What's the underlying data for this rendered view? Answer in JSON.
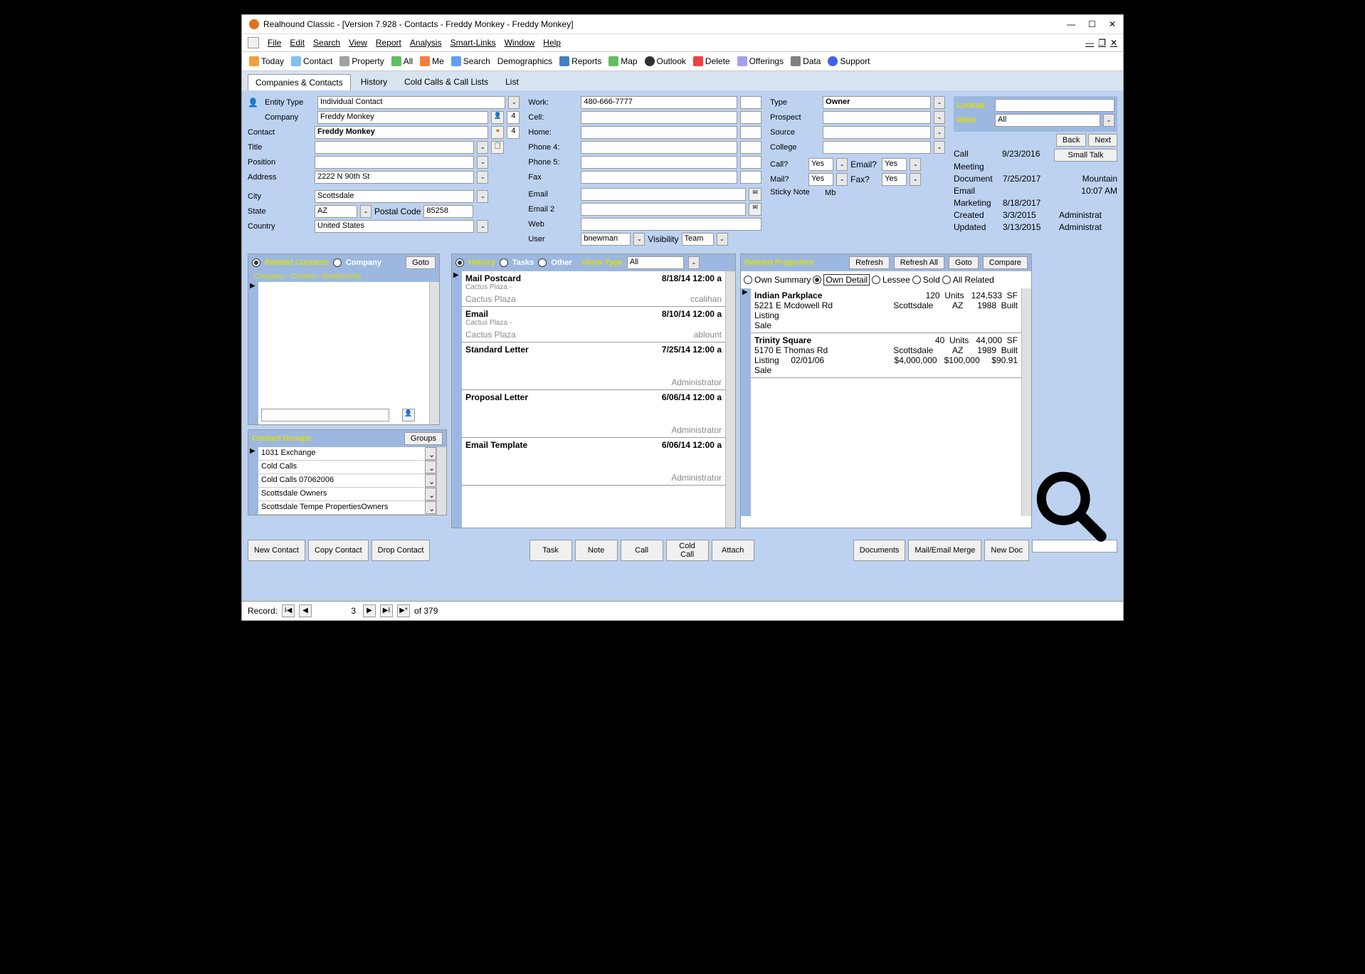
{
  "window": {
    "title": "Realhound Classic - [Version 7.928 - Contacts - Freddy Monkey - Freddy Monkey]"
  },
  "menubar": {
    "items": [
      "File",
      "Edit",
      "Search",
      "View",
      "Report",
      "Analysis",
      "Smart-Links",
      "Window",
      "Help"
    ]
  },
  "toolbar": {
    "items": [
      "Today",
      "Contact",
      "Property",
      "All",
      "Me",
      "Search",
      "Demographics",
      "Reports",
      "Map",
      "Outlook",
      "Delete",
      "Offerings",
      "Data",
      "Support"
    ]
  },
  "tabs": {
    "items": [
      "Companies & Contacts",
      "History",
      "Cold Calls & Call Lists",
      "List"
    ],
    "active": 0
  },
  "contact": {
    "entity_type_label": "Entity Type",
    "entity_type": "Individual Contact",
    "company_label": "Company",
    "company": "Freddy Monkey",
    "company_count": "4",
    "contact_label": "Contact",
    "contact": "Freddy Monkey",
    "contact_count": "4",
    "title_label": "Title",
    "title": "",
    "position_label": "Position",
    "position": "",
    "address_label": "Address",
    "address": "2222 N 90th St",
    "city_label": "City",
    "city": "Scottsdale",
    "state_label": "State",
    "state": "AZ",
    "postal_label": "Postal Code",
    "postal": "85258",
    "country_label": "Country",
    "country": "United States"
  },
  "phones": {
    "work_label": "Work:",
    "work": "480-666-7777",
    "cell_label": "Cell:",
    "cell": "",
    "home_label": "Home:",
    "home": "",
    "p4_label": "Phone 4:",
    "p4": "",
    "p5_label": "Phone 5:",
    "p5": "",
    "fax_label": "Fax",
    "fax": "",
    "email_label": "Email",
    "email": "",
    "email2_label": "Email 2",
    "email2": "",
    "web_label": "Web",
    "web": "",
    "user_label": "User",
    "user": "bnewman",
    "visibility_label": "Visibility",
    "visibility": "Team"
  },
  "classify": {
    "type_label": "Type",
    "type": "Owner",
    "prospect_label": "Prospect",
    "prospect": "",
    "source_label": "Source",
    "source": "",
    "college_label": "College",
    "college": "",
    "call_label": "Call?",
    "call": "Yes",
    "email_q_label": "Email?",
    "email_q": "Yes",
    "mail_label": "Mail?",
    "mail": "Yes",
    "fax_q_label": "Fax?",
    "fax_q": "Yes",
    "sticky_label": "Sticky Note",
    "sticky": "Mb"
  },
  "lookup": {
    "lookup_label": "Lookup",
    "what_label": "What",
    "what": "All",
    "back": "Back",
    "next": "Next",
    "smalltalk": "Small Talk"
  },
  "info": {
    "call_label": "Call",
    "call": "9/23/2016",
    "meeting_label": "Meeting",
    "meeting": "",
    "document_label": "Document",
    "document": "7/25/2017",
    "mountain": "Mountain",
    "email_label": "Email",
    "email": "",
    "time": "10:07 AM",
    "marketing_label": "Marketing",
    "marketing": "8/18/2017",
    "created_label": "Created",
    "created": "3/3/2015",
    "created_by": "Administrat",
    "updated_label": "Updated",
    "updated": "3/13/2015",
    "updated_by": "Administrat"
  },
  "related_contacts": {
    "rc_label": "Related Contacts",
    "company_label": "Company",
    "goto": "Goto",
    "columns": "Company - Contact - Relationship"
  },
  "history_panel": {
    "history_label": "History",
    "tasks_label": "Tasks",
    "other_label": "Other",
    "show_label": "Show Type",
    "show": "All",
    "items": [
      {
        "title": "Mail Postcard",
        "date": "8/18/14 12:00 a",
        "sub": "Cactus Plaza -",
        "foot_l": "Cactus Plaza",
        "foot_r": "ccalihan"
      },
      {
        "title": "Email",
        "date": "8/10/14 12:00 a",
        "sub": "Cactus Plaza -",
        "foot_l": "Cactus Plaza",
        "foot_r": "ablount"
      },
      {
        "title": "Standard Letter",
        "date": "7/25/14 12:00 a",
        "sub": "",
        "foot_l": "",
        "foot_r": "Administrator"
      },
      {
        "title": "Proposal Letter",
        "date": "6/06/14 12:00 a",
        "sub": "",
        "foot_l": "",
        "foot_r": "Administrator"
      },
      {
        "title": "Email Template",
        "date": "6/06/14 12:00 a",
        "sub": "",
        "foot_l": "",
        "foot_r": "Administrator"
      }
    ]
  },
  "contact_groups": {
    "title": "Contact Groups",
    "groups_btn": "Groups",
    "items": [
      "1031 Exchange",
      "Cold Calls",
      "Cold Calls 07062006",
      "Scottsdale Owners",
      "Scottsdale Tempe PropertiesOwners"
    ]
  },
  "related_props": {
    "title": "Related Properties",
    "refresh": "Refresh",
    "refresh_all": "Refresh All",
    "goto": "Goto",
    "compare": "Compare",
    "radios": [
      "Own Summary",
      "Own Detail",
      "Lessee",
      "Sold",
      "All Related"
    ],
    "items": [
      {
        "name": "Indian Parkplace",
        "units": "120",
        "units_l": "Units",
        "size": "124,533",
        "sf": "SF",
        "addr": "5221 E Mcdowell Rd",
        "city": "Scottsdale",
        "state": "AZ",
        "year": "1988",
        "built": "Built",
        "listing": "Listing",
        "sale": "Sale"
      },
      {
        "name": "Trinity Square",
        "units": "40",
        "units_l": "Units",
        "size": "44,000",
        "sf": "SF",
        "addr": "5170 E Thomas Rd",
        "city": "Scottsdale",
        "state": "AZ",
        "year": "1989",
        "built": "Built",
        "listing": "Listing",
        "list_date": "02/01/06",
        "price": "$4,000,000",
        "price2": "$100,000",
        "psf": "$90.91",
        "sale": "Sale"
      }
    ]
  },
  "bottom_left": [
    "New Contact",
    "Copy Contact",
    "Drop Contact"
  ],
  "bottom_mid": [
    "Task",
    "Note",
    "Call",
    "Cold Call",
    "Attach"
  ],
  "bottom_right": [
    "Documents",
    "Mail/Email Merge",
    "New Doc"
  ],
  "status": {
    "record": "Record:",
    "current": "3",
    "of": "of 379"
  }
}
